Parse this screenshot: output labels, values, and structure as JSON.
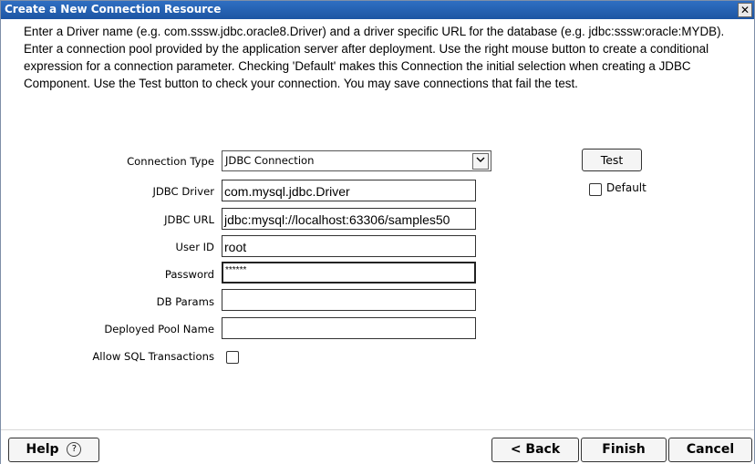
{
  "window": {
    "title": "Create a New Connection Resource",
    "close_glyph": "✕"
  },
  "description": "Enter a Driver name (e.g. com.sssw.jdbc.oracle8.Driver) and a driver specific URL for the database (e.g. jdbc:sssw:oracle:MYDB). Enter a connection pool provided by the application server after deployment. Use the right mouse button to create a conditional expression for a connection parameter. Checking 'Default' makes this Connection the initial selection when creating a JDBC Component. Use the Test button to check your connection. You may save connections that fail the test.",
  "form": {
    "connection_type": {
      "label": "Connection Type",
      "value": "JDBC Connection"
    },
    "jdbc_driver": {
      "label": "JDBC Driver",
      "value": "com.mysql.jdbc.Driver"
    },
    "jdbc_url": {
      "label": "JDBC URL",
      "value": "jdbc:mysql://localhost:63306/samples50"
    },
    "user_id": {
      "label": "User ID",
      "value": "root"
    },
    "password": {
      "label": "Password",
      "value": "******"
    },
    "db_params": {
      "label": "DB Params",
      "value": ""
    },
    "deployed_pool_name": {
      "label": "Deployed Pool Name",
      "value": ""
    },
    "allow_sql_transactions": {
      "label": "Allow SQL Transactions",
      "checked": false
    }
  },
  "side": {
    "test_label": "Test",
    "default_label": "Default",
    "default_checked": false
  },
  "footer": {
    "help_label": "Help",
    "help_icon": "?",
    "back_label": "< Back",
    "finish_label": "Finish",
    "cancel_label": "Cancel"
  },
  "colors": {
    "titlebar": "#1f5aa8",
    "title_text": "#ffffff"
  }
}
